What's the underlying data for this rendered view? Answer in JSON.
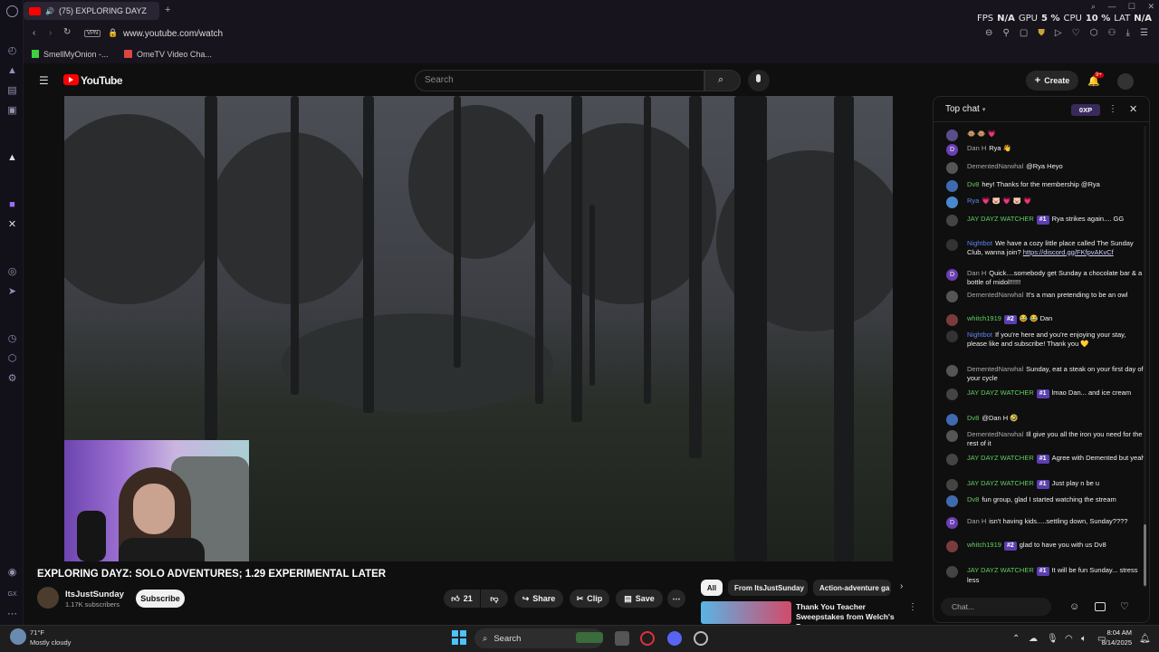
{
  "browser": {
    "tab_title": "(75) EXPLORING DAYZ",
    "address": "www.youtube.com/watch",
    "vpn_label": "VPN",
    "bookmarks": [
      {
        "label": "SmellMyOnion -..."
      },
      {
        "label": "OmeTV Video Cha..."
      }
    ],
    "sysinfo": {
      "fps_label": "FPS",
      "fps_value": "N/A",
      "gpu_label": "GPU",
      "gpu_value": "5 %",
      "cpu_label": "CPU",
      "cpu_value": "10 %",
      "lat_label": "LAT",
      "lat_value": "N/A"
    }
  },
  "youtube": {
    "logo_text": "YouTube",
    "search_placeholder": "Search",
    "create_label": "Create",
    "notification_count": "9+"
  },
  "video": {
    "title": "EXPLORING DAYZ: SOLO ADVENTURES; 1.29 EXPERIMENTAL LATER",
    "channel": "ItsJustSunday",
    "subscribers": "1.17K subscribers",
    "subscribe_label": "Subscribe",
    "likes": "21",
    "share_label": "Share",
    "clip_label": "Clip",
    "save_label": "Save"
  },
  "chips": [
    {
      "label": "All",
      "active": true
    },
    {
      "label": "From ItsJustSunday",
      "active": false
    },
    {
      "label": "Action-adventure ga",
      "active": false
    }
  ],
  "recommended": {
    "title": "Thank You Teacher Sweepstakes from Welch's Fru..."
  },
  "chat": {
    "header": "Top chat",
    "xp_label": "0XP",
    "input_placeholder": "Chat...",
    "messages": [
      {
        "author": "",
        "badge": "",
        "text": "🐵 🐵 💗",
        "av": ""
      },
      {
        "author": "Dan H",
        "badge": "",
        "text": "Rya 👋",
        "av": "D"
      },
      {
        "author": "DementedNarwhal",
        "badge": "",
        "text": "@Rya Heyo",
        "av": ""
      },
      {
        "author": "Dv8",
        "badge": "",
        "text": "hey! Thanks for the membership @Rya",
        "av": ""
      },
      {
        "author": "Rya",
        "badge": "",
        "text": "💗 🐷 💗 🐷 💗",
        "av": ""
      },
      {
        "author": "JAY DAYZ WATCHER",
        "badge": "#1",
        "text": "Rya strikes again.... GG",
        "av": ""
      },
      {
        "author": "Nightbot",
        "badge": "",
        "text": "We have a cozy little place called The Sunday Club, wanna join? ",
        "link": "https://discord.gg/FKfpvAKvCf",
        "av": ""
      },
      {
        "author": "Dan H",
        "badge": "",
        "text": "Quick....somebody get Sunday a chocolate bar & a bottle of midol!!!!!!",
        "av": "D"
      },
      {
        "author": "DementedNarwhal",
        "badge": "",
        "text": "It's a man pretending to be an owl",
        "av": ""
      },
      {
        "author": "whitch1919",
        "badge": "#2",
        "text": "😂 😂 Dan",
        "av": ""
      },
      {
        "author": "Nightbot",
        "badge": "",
        "text": "If you're here and you're enjoying your stay, please like and subscribe! Thank you 💛",
        "av": ""
      },
      {
        "author": "DementedNarwhal",
        "badge": "",
        "text": "Sunday, eat a steak on your first day of your cycle",
        "av": ""
      },
      {
        "author": "JAY DAYZ WATCHER",
        "badge": "#1",
        "text": "lmao Dan... and ice cream",
        "av": ""
      },
      {
        "author": "Dv8",
        "badge": "",
        "text": "@Dan H 🤣",
        "av": ""
      },
      {
        "author": "DementedNarwhal",
        "badge": "",
        "text": "Ill give you all the iron you need for the rest of it",
        "av": ""
      },
      {
        "author": "JAY DAYZ WATCHER",
        "badge": "#1",
        "text": "Agree with Demented but yeah",
        "av": ""
      },
      {
        "author": "JAY DAYZ WATCHER",
        "badge": "#1",
        "text": "Just play n be u",
        "av": ""
      },
      {
        "author": "Dv8",
        "badge": "",
        "text": "fun group, glad I started watching the stream",
        "av": ""
      },
      {
        "author": "Dan H",
        "badge": "",
        "text": "isn't having kids.....settling down, Sunday????",
        "av": "D"
      },
      {
        "author": "whitch1919",
        "badge": "#2",
        "text": "glad to have you with us Dv8",
        "av": ""
      },
      {
        "author": "JAY DAYZ WATCHER",
        "badge": "#1",
        "text": "It will be fun Sunday... stress less",
        "av": ""
      }
    ]
  },
  "taskbar": {
    "temp": "71°F",
    "weather": "Mostly cloudy",
    "search_label": "Search",
    "time": "8:04 AM",
    "date": "8/14/2025"
  }
}
